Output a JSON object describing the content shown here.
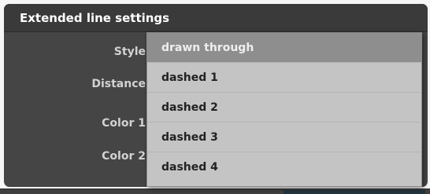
{
  "panel": {
    "title": "Extended line settings",
    "labels": [
      "Style",
      "Distance",
      "Color 1",
      "Color 2"
    ]
  },
  "dropdown": {
    "options": [
      "drawn through",
      "dashed 1",
      "dashed 2",
      "dashed 3",
      "dashed 4"
    ],
    "selected_index": 0
  },
  "colors": {
    "panel_bg": "#454545",
    "header_bg": "#3a3a3a",
    "dropdown_bg": "#c4c4c4",
    "selected_bg": "#8e8e8e"
  }
}
